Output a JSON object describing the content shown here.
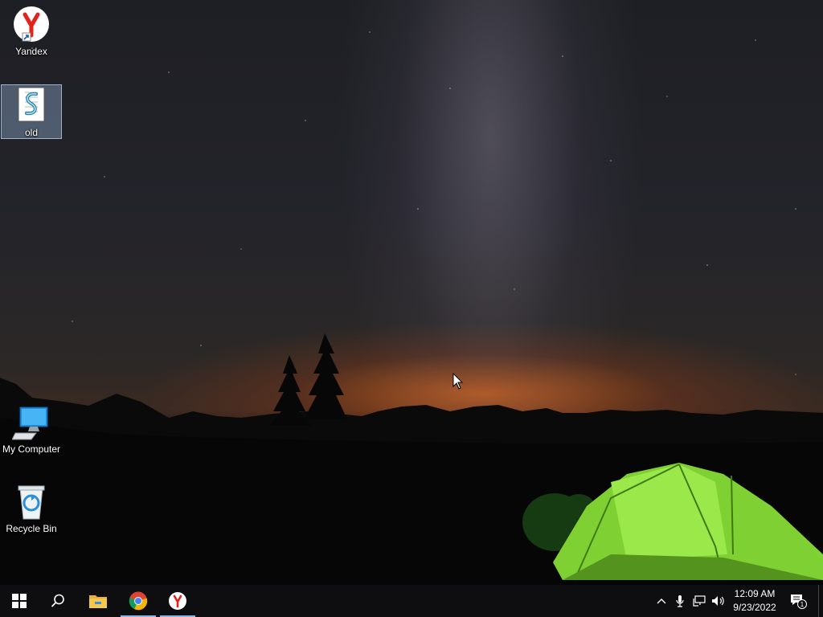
{
  "desktop": {
    "icons": [
      {
        "label": "Yandex",
        "icon": "yandex-icon",
        "shortcut": true
      },
      {
        "label": "old",
        "icon": "script-file-icon",
        "selected": true
      },
      {
        "label": "My Computer",
        "icon": "computer-icon"
      },
      {
        "label": "Recycle Bin",
        "icon": "recycle-bin-icon"
      }
    ]
  },
  "taskbar": {
    "start": {
      "icon": "windows-logo-icon"
    },
    "search": {
      "icon": "search-icon"
    },
    "pinned": [
      {
        "app": "File Explorer",
        "icon": "folder-icon",
        "active": false
      },
      {
        "app": "Google Chrome",
        "icon": "chrome-icon",
        "active": true
      },
      {
        "app": "Yandex",
        "icon": "yandex-icon",
        "active": true
      }
    ],
    "tray": {
      "icons": [
        "chevron-up-icon",
        "microphone-icon",
        "network-icon",
        "speaker-icon"
      ],
      "time": "12:09 AM",
      "date": "9/23/2022",
      "notification_count": "1"
    }
  },
  "colors": {
    "taskbar_bg": "#0e0e10",
    "active_indicator": "#8ab4e8",
    "yandex_red": "#e2231a",
    "tent_green": "#8ee03a"
  }
}
